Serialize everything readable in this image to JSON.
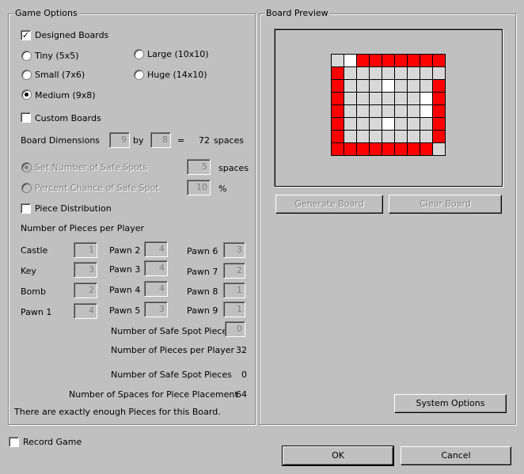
{
  "game_options": {
    "title": "Game Options",
    "designed_boards": {
      "label": "Designed Boards",
      "checked": true
    },
    "sizes": {
      "tiny": "Tiny (5x5)",
      "small": "Small (7x6)",
      "medium": "Medium (9x8)",
      "large": "Large (10x10)",
      "huge": "Huge (14x10)",
      "selected": "Medium (9x8)"
    },
    "custom_boards": {
      "label": "Custom Boards",
      "checked": false
    },
    "board_dimensions": {
      "label": "Board Dimensions",
      "width": "9",
      "by": "by",
      "height": "8",
      "equals": "=",
      "spaces_count": "72",
      "spaces_label": "spaces"
    },
    "set_safe_spots": {
      "label": "Set Number of Safe Spots",
      "value": "5",
      "unit": "spaces"
    },
    "percent_safe": {
      "label": "Percent Chance of Safe Spot",
      "value": "10",
      "unit": "%"
    },
    "piece_distribution": {
      "label": "Piece Distribution",
      "checked": false
    },
    "pieces_per_player_title": "Number of Pieces per Player",
    "pieces": {
      "castle": {
        "label": "Castle",
        "value": "1"
      },
      "key": {
        "label": "Key",
        "value": "3"
      },
      "bomb": {
        "label": "Bomb",
        "value": "2"
      },
      "pawn1": {
        "label": "Pawn 1",
        "value": "4"
      },
      "pawn2": {
        "label": "Pawn 2",
        "value": "4"
      },
      "pawn3": {
        "label": "Pawn 3",
        "value": "4"
      },
      "pawn4": {
        "label": "Pawn 4",
        "value": "4"
      },
      "pawn5": {
        "label": "Pawn 5",
        "value": "3"
      },
      "pawn6": {
        "label": "Pawn 6",
        "value": "3"
      },
      "pawn7": {
        "label": "Pawn 7",
        "value": "2"
      },
      "pawn8": {
        "label": "Pawn 8",
        "value": "1"
      },
      "pawn9": {
        "label": "Pawn 9",
        "value": "1"
      }
    },
    "safe_spot_pieces_input": {
      "label": "Number of Safe Spot Pieces",
      "value": "0"
    },
    "summary": {
      "pieces_per_player_label": "Number of Pieces per Player",
      "pieces_per_player_value": "32",
      "safe_spot_pieces_label": "Number of Safe Spot Pieces",
      "safe_spot_pieces_value": "0",
      "spaces_for_placement_label": "Number of Spaces for Piece Placement",
      "spaces_for_placement_value": "64"
    },
    "status_message": "There are exactly enough Pieces for this Board."
  },
  "board_preview": {
    "title": "Board Preview",
    "grid": [
      "gwrrrrrrr",
      "rggggggggr",
      "rgggwgggr",
      "rggggggwr",
      "rggggggwr",
      "rgggwgggr",
      "rgggggggr",
      "rrrrrrrrg"
    ],
    "colors": {
      "red": "#ff0000",
      "white": "#ffffff",
      "gray": "#d8d8d8"
    },
    "generate_button": "Generate Board",
    "clear_button": "Clear Board",
    "system_options_button": "System Options"
  },
  "record_game": {
    "label": "Record Game",
    "checked": false
  },
  "ok_button": "OK",
  "cancel_button": "Cancel"
}
